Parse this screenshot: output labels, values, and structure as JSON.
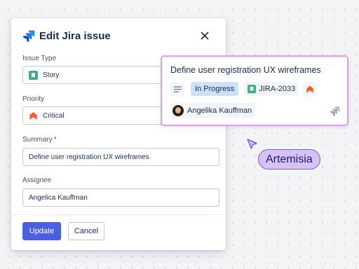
{
  "dialog": {
    "title": "Edit Jira issue",
    "fields": {
      "issue_type": {
        "label": "Issue Type",
        "value": "Story",
        "icon": "story-icon"
      },
      "priority": {
        "label": "Priority",
        "value": "Critical",
        "icon": "critical-priority-icon"
      },
      "summary": {
        "label": "Summary",
        "required_mark": "*",
        "value": "Define user registration UX wireframes"
      },
      "assignee": {
        "label": "Assignee",
        "value": "Angelica Kauffman"
      }
    },
    "buttons": {
      "update": "Update",
      "cancel": "Cancel"
    }
  },
  "card": {
    "title": "Define user registration UX wireframes",
    "status": "In Progress",
    "issue_key": "JIRA-2033",
    "assignee": "Angelika Kauffman"
  },
  "collaborator": {
    "name": "Artemisia"
  },
  "colors": {
    "accent": "#4b5fe5",
    "jira_blue": "#2684ff",
    "story_green": "#36b37e",
    "critical": "#ff5630",
    "card_border": "#e59af0",
    "cursor_fill": "#d5c2fb",
    "cursor_border": "#7b5ce0"
  }
}
